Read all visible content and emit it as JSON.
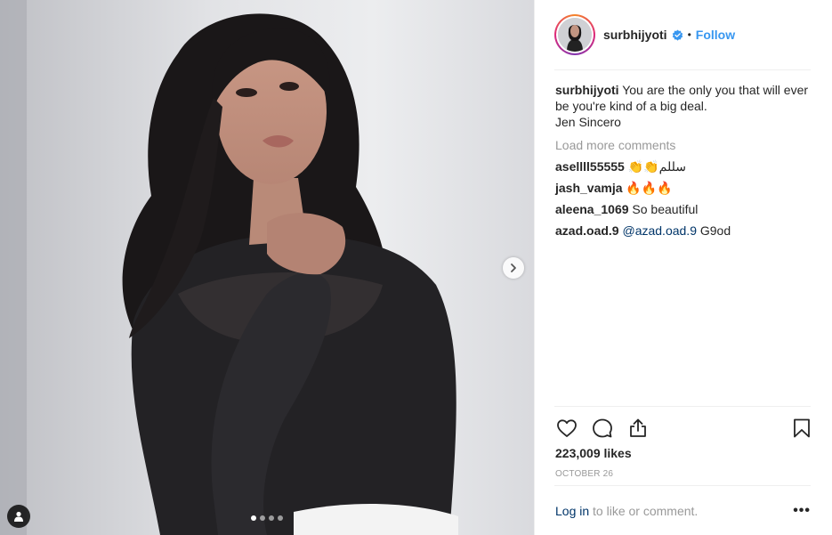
{
  "post": {
    "username": "surbhijyoti",
    "verified": true,
    "separator": "•",
    "follow_label": "Follow",
    "caption_user": "surbhijyoti",
    "caption_text": "You are the only you that will ever be you're kind of a big deal.",
    "caption_line2": "Jen Sincero",
    "load_more_label": "Load more comments",
    "comments": [
      {
        "user": "asellll55555",
        "text": "👏👏سللم"
      },
      {
        "user": "jash_vamja",
        "text": "🔥🔥🔥"
      },
      {
        "user": "aleena_1069",
        "text": "So beautiful"
      },
      {
        "user": "azad.oad.9",
        "mention": "@azad.oad.9",
        "text": "G9od"
      }
    ],
    "likes_text": "223,009 likes",
    "date_text": "OCTOBER 26",
    "login_link": "Log in",
    "login_suffix": " to like or comment.",
    "more_options": "•••"
  },
  "carousel": {
    "current": 1,
    "total": 4
  },
  "icons": {
    "like": "heart-icon",
    "comment": "comment-icon",
    "share": "share-icon",
    "save": "bookmark-icon",
    "next": "chevron-right-icon",
    "tag": "user-tag-icon",
    "verified": "verified-badge-icon"
  },
  "colors": {
    "accent": "#3897f0",
    "link": "#003569",
    "muted": "#999999",
    "text": "#262626"
  }
}
